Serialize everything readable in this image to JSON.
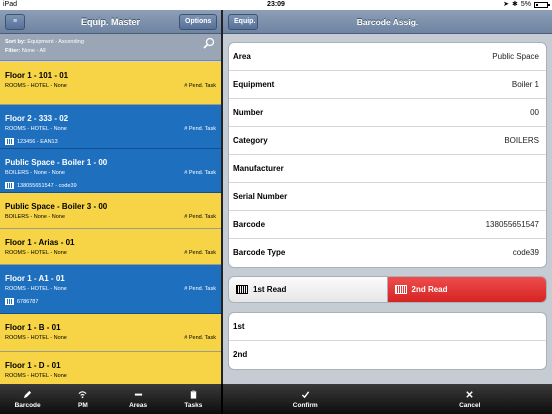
{
  "status_bar": {
    "device": "iPad",
    "time": "23:09",
    "battery": "5%"
  },
  "left_pane": {
    "title": "Equip. Master",
    "menu_label": "≡",
    "options_label": "Options",
    "sort_label": "Sort by:",
    "sort_value": "Equipment - Ascending",
    "filter_label": "Filter:",
    "filter_value": "None - All",
    "items": [
      {
        "title": "Floor 1 - 101 - 01",
        "subtitle": "ROOMS - HOTEL - None",
        "task": "# Pend. Task",
        "barcode": "",
        "color": "yellow"
      },
      {
        "title": "Floor 2 - 333 - 02",
        "subtitle": "ROOMS - HOTEL - None",
        "task": "# Pend. Task",
        "barcode": "123456 - EAN13",
        "color": "blue"
      },
      {
        "title": "Public Space - Boiler 1 - 00",
        "subtitle": "BOILERS - None - None",
        "task": "# Pend. Task",
        "barcode": "138055651547 - code39",
        "color": "blue"
      },
      {
        "title": "Public Space - Boiler 3 - 00",
        "subtitle": "BOILERS - None - None",
        "task": "# Pend. Task",
        "barcode": "",
        "color": "yellow"
      },
      {
        "title": "Floor 1 - Arias - 01",
        "subtitle": "ROOMS - HOTEL - None",
        "task": "# Pend. Task",
        "barcode": "",
        "color": "yellow"
      },
      {
        "title": "Floor 1 - A1 - 01",
        "subtitle": "ROOMS - HOTEL - None",
        "task": "# Pend. Task",
        "barcode": "6786787",
        "color": "blue"
      },
      {
        "title": "Floor 1 - B - 01",
        "subtitle": "ROOMS - HOTEL - None",
        "task": "# Pend. Task",
        "barcode": "",
        "color": "yellow"
      },
      {
        "title": "Floor 1 - D - 01",
        "subtitle": "ROOMS - HOTEL - None",
        "task": "",
        "barcode": "",
        "color": "yellow"
      }
    ],
    "tabs": [
      {
        "label": "Barcode",
        "icon": "pencil-icon"
      },
      {
        "label": "PM",
        "icon": "wifi-icon"
      },
      {
        "label": "Areas",
        "icon": "minus-icon"
      },
      {
        "label": "Tasks",
        "icon": "clipboard-icon"
      }
    ]
  },
  "right_pane": {
    "title": "Barcode Assig.",
    "back_label": "Equip.",
    "details": [
      {
        "label": "Area",
        "value": "Public Space"
      },
      {
        "label": "Equipment",
        "value": "Boiler 1"
      },
      {
        "label": "Number",
        "value": "00"
      },
      {
        "label": "Category",
        "value": "BOILERS"
      },
      {
        "label": "Manufacturer",
        "value": ""
      },
      {
        "label": "Serial Number",
        "value": ""
      },
      {
        "label": "Barcode",
        "value": "138055651547"
      },
      {
        "label": "Barcode Type",
        "value": "code39"
      }
    ],
    "read_first": "1st Read",
    "read_second": "2nd Read",
    "reads": [
      {
        "label": "1st",
        "value": ""
      },
      {
        "label": "2nd",
        "value": ""
      }
    ],
    "confirm_label": "Confirm",
    "cancel_label": "Cancel"
  },
  "colors": {
    "yellow": "#f6d445",
    "blue": "#1f6fbf",
    "accent_red": "#e13a3a"
  }
}
